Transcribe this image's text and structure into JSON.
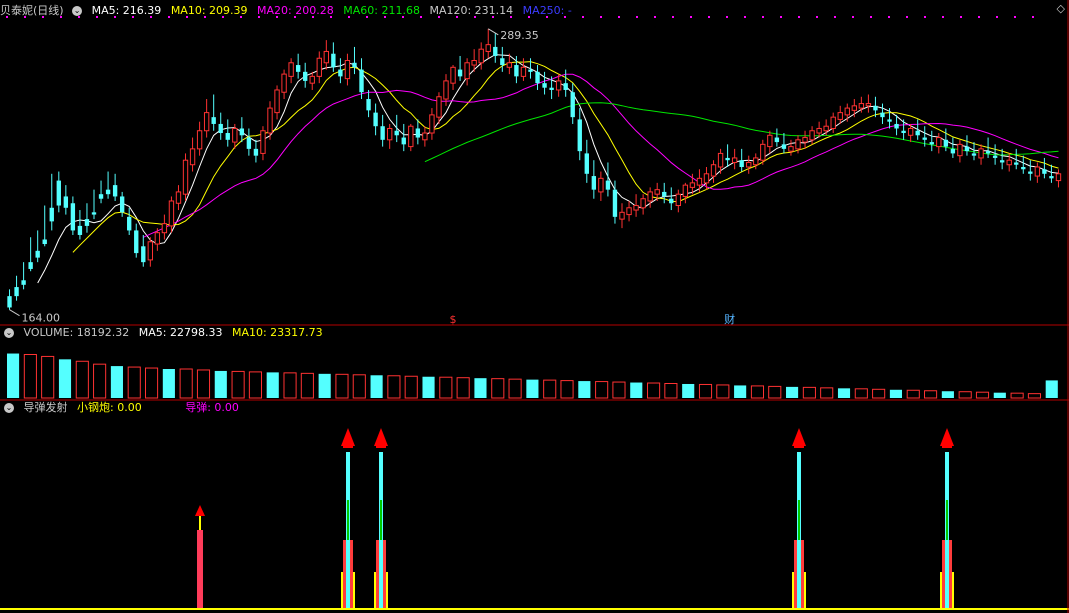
{
  "main_header": {
    "stock_name": "贝泰妮(日线)",
    "ma5": "MA5: 216.39",
    "ma10": "MA10: 209.39",
    "ma20": "MA20: 200.28",
    "ma60": "MA60: 211.68",
    "ma120": "MA120: 231.14",
    "ma250": "MA250: -"
  },
  "vol_header": {
    "volume": "VOLUME: 18192.32",
    "ma5": "MA5: 22798.33",
    "ma10": "MA10: 23317.73"
  },
  "ind_header": {
    "name": "导弹发射",
    "xiao": "小钢炮: 0.00",
    "daodan": "导弹: 0.00"
  },
  "colors": {
    "up": "#ff3232",
    "down": "#54ffff",
    "ma5": "#ffffff",
    "ma10": "#ffff00",
    "ma20": "#ff00ff",
    "ma60": "#00e600",
    "ma120": "#c8c8c8",
    "ma250": "#3c3cff",
    "border": "#b40000",
    "text": "#c8c8c8",
    "dots": "#ff00ff"
  },
  "chart_data": {
    "type": "candlestick",
    "title": "贝泰妮(日线)",
    "ylim": [
      164,
      289.35
    ],
    "max_label": "289.35",
    "min_label": "164.00",
    "markers": [
      "$",
      "财"
    ],
    "candles": [
      [
        171,
        174,
        166,
        165
      ],
      [
        175,
        180,
        171,
        169
      ],
      [
        178,
        186,
        176,
        174
      ],
      [
        186,
        197,
        183,
        182
      ],
      [
        191,
        200,
        188,
        186
      ],
      [
        196,
        211,
        194,
        193
      ],
      [
        210,
        225,
        204,
        200
      ],
      [
        222,
        226,
        211,
        208
      ],
      [
        215,
        220,
        210,
        207
      ],
      [
        212,
        215,
        200,
        198
      ],
      [
        202,
        209,
        198,
        196
      ],
      [
        205,
        212,
        202,
        199
      ],
      [
        208,
        218,
        207,
        205
      ],
      [
        216,
        222,
        214,
        212
      ],
      [
        218,
        226,
        216,
        214
      ],
      [
        220,
        225,
        215,
        213
      ],
      [
        215,
        217,
        208,
        206
      ],
      [
        206,
        210,
        200,
        198
      ],
      [
        200,
        203,
        190,
        188
      ],
      [
        193,
        198,
        186,
        184
      ],
      [
        187,
        197,
        195,
        184
      ],
      [
        194,
        201,
        199,
        191
      ],
      [
        199,
        207,
        203,
        196
      ],
      [
        202,
        215,
        213,
        199
      ],
      [
        212,
        220,
        217,
        209
      ],
      [
        216,
        234,
        231,
        213
      ],
      [
        229,
        241,
        236,
        226
      ],
      [
        236,
        248,
        244,
        233
      ],
      [
        244,
        258,
        252,
        241
      ],
      [
        250,
        260,
        247,
        244
      ],
      [
        247,
        252,
        243,
        240
      ],
      [
        243,
        249,
        240,
        237
      ],
      [
        239,
        247,
        245,
        236
      ],
      [
        245,
        250,
        242,
        239
      ],
      [
        241,
        245,
        236,
        233
      ],
      [
        236,
        240,
        233,
        230
      ],
      [
        234,
        246,
        244,
        231
      ],
      [
        243,
        257,
        254,
        240
      ],
      [
        252,
        264,
        262,
        249
      ],
      [
        261,
        271,
        269,
        258
      ],
      [
        268,
        276,
        274,
        265
      ],
      [
        273,
        278,
        270,
        267
      ],
      [
        270,
        274,
        266,
        263
      ],
      [
        265,
        270,
        268,
        262
      ],
      [
        268,
        279,
        276,
        265
      ],
      [
        274,
        284,
        279,
        271
      ],
      [
        278,
        283,
        272,
        270
      ],
      [
        271,
        276,
        268,
        265
      ],
      [
        267,
        278,
        275,
        264
      ],
      [
        274,
        281,
        272,
        269
      ],
      [
        271,
        276,
        261,
        258
      ],
      [
        258,
        262,
        253,
        250
      ],
      [
        252,
        256,
        246,
        242
      ],
      [
        246,
        251,
        240,
        237
      ],
      [
        240,
        247,
        245,
        236
      ],
      [
        244,
        251,
        242,
        239
      ],
      [
        241,
        247,
        238,
        235
      ],
      [
        237,
        247,
        246,
        235
      ],
      [
        245,
        249,
        241,
        238
      ],
      [
        240,
        246,
        243,
        237
      ],
      [
        243,
        254,
        251,
        240
      ],
      [
        250,
        261,
        259,
        247
      ],
      [
        258,
        269,
        266,
        255
      ],
      [
        265,
        273,
        272,
        262
      ],
      [
        271,
        277,
        268,
        266
      ],
      [
        267,
        276,
        274,
        264
      ],
      [
        273,
        280,
        275,
        270
      ],
      [
        274,
        283,
        280,
        271
      ],
      [
        279,
        289,
        282,
        276
      ],
      [
        281,
        287,
        277,
        274
      ],
      [
        276,
        281,
        273,
        270
      ],
      [
        272,
        278,
        274,
        269
      ],
      [
        273,
        277,
        268,
        265
      ],
      [
        268,
        276,
        272,
        266
      ],
      [
        271,
        276,
        270,
        267
      ],
      [
        270,
        273,
        265,
        262
      ],
      [
        265,
        270,
        263,
        260
      ],
      [
        263,
        268,
        262,
        258
      ],
      [
        262,
        269,
        266,
        259
      ],
      [
        265,
        271,
        262,
        259
      ],
      [
        261,
        265,
        250,
        247
      ],
      [
        249,
        254,
        235,
        231
      ],
      [
        234,
        240,
        225,
        221
      ],
      [
        224,
        231,
        218,
        214
      ],
      [
        217,
        226,
        223,
        213
      ],
      [
        222,
        230,
        218,
        215
      ],
      [
        218,
        222,
        206,
        203
      ],
      [
        205,
        212,
        208,
        201
      ],
      [
        207,
        213,
        210,
        204
      ],
      [
        209,
        216,
        211,
        206
      ],
      [
        210,
        216,
        214,
        207
      ],
      [
        213,
        219,
        217,
        210
      ],
      [
        216,
        221,
        218,
        213
      ],
      [
        217,
        221,
        215,
        212
      ],
      [
        214,
        219,
        212,
        209
      ],
      [
        211,
        218,
        216,
        208
      ],
      [
        215,
        221,
        220,
        212
      ],
      [
        219,
        225,
        221,
        216
      ],
      [
        220,
        227,
        223,
        217
      ],
      [
        221,
        228,
        225,
        218
      ],
      [
        224,
        231,
        229,
        221
      ],
      [
        228,
        236,
        234,
        225
      ],
      [
        232,
        238,
        231,
        228
      ],
      [
        230,
        236,
        232,
        227
      ],
      [
        231,
        236,
        228,
        226
      ],
      [
        228,
        233,
        230,
        225
      ],
      [
        229,
        234,
        232,
        227
      ],
      [
        231,
        240,
        238,
        229
      ],
      [
        237,
        244,
        242,
        234
      ],
      [
        241,
        245,
        239,
        237
      ],
      [
        238,
        243,
        236,
        234
      ],
      [
        235,
        240,
        237,
        233
      ],
      [
        236,
        242,
        240,
        234
      ],
      [
        239,
        244,
        241,
        236
      ],
      [
        240,
        246,
        244,
        238
      ],
      [
        243,
        248,
        245,
        241
      ],
      [
        244,
        249,
        246,
        242
      ],
      [
        245,
        252,
        250,
        243
      ],
      [
        249,
        255,
        252,
        247
      ],
      [
        251,
        256,
        254,
        248
      ],
      [
        253,
        258,
        255,
        250
      ],
      [
        254,
        259,
        256,
        252
      ],
      [
        255,
        260,
        256,
        252
      ],
      [
        255,
        259,
        253,
        250
      ],
      [
        252,
        256,
        250,
        247
      ],
      [
        249,
        254,
        248,
        245
      ],
      [
        247,
        251,
        245,
        242
      ],
      [
        244,
        249,
        243,
        240
      ],
      [
        242,
        247,
        245,
        239
      ],
      [
        244,
        249,
        242,
        240
      ],
      [
        241,
        246,
        240,
        237
      ],
      [
        239,
        244,
        238,
        235
      ],
      [
        237,
        243,
        241,
        234
      ],
      [
        240,
        245,
        237,
        235
      ],
      [
        236,
        241,
        234,
        232
      ],
      [
        233,
        240,
        238,
        230
      ],
      [
        237,
        242,
        235,
        233
      ],
      [
        234,
        239,
        233,
        231
      ],
      [
        232,
        238,
        236,
        229
      ],
      [
        235,
        241,
        234,
        232
      ],
      [
        233,
        238,
        232,
        229
      ],
      [
        231,
        236,
        230,
        227
      ],
      [
        229,
        234,
        231,
        226
      ],
      [
        230,
        236,
        229,
        227
      ],
      [
        228,
        233,
        227,
        225
      ],
      [
        226,
        231,
        225,
        222
      ],
      [
        224,
        230,
        228,
        221
      ],
      [
        227,
        232,
        225,
        223
      ],
      [
        224,
        229,
        223,
        221
      ],
      [
        222,
        227,
        225,
        219
      ]
    ],
    "volume": {
      "ylim": [
        0,
        60000
      ],
      "values": [
        46000,
        45000,
        43000,
        40000,
        38000,
        35000,
        33000,
        32000,
        31000,
        30000,
        30000,
        29000,
        28000,
        27500,
        27000,
        26500,
        26000,
        25500,
        25000,
        24500,
        24000,
        23500,
        23000,
        22500,
        22000,
        21500,
        21000,
        20500,
        20000,
        19500,
        19000,
        18500,
        18000,
        17500,
        17000,
        16500,
        16000,
        15500,
        15000,
        14500,
        14000,
        13500,
        13000,
        12500,
        12000,
        11500,
        11000,
        10500,
        10000,
        9500,
        9000,
        8500,
        8000,
        7500,
        7000,
        6500,
        6000,
        5500,
        5000,
        4500,
        18192
      ]
    },
    "indicator": {
      "name": "导弹发射",
      "series": [
        {
          "name": "小钢炮",
          "value": 0.0
        },
        {
          "name": "导弹",
          "value": 0.0
        }
      ],
      "signals": [
        "small",
        "large",
        "large",
        "large",
        "large"
      ]
    }
  }
}
